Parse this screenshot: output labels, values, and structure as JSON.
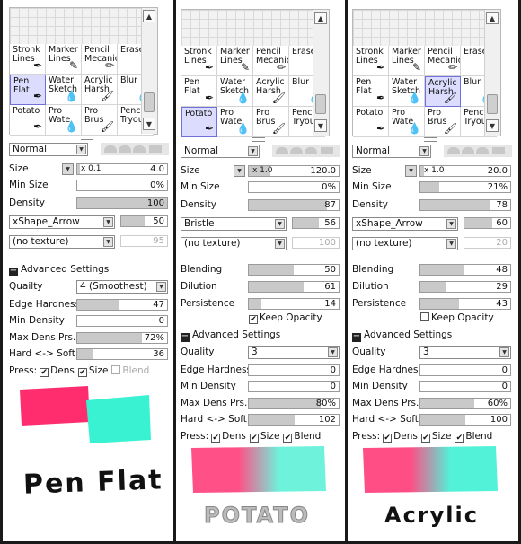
{
  "brushes": {
    "row1": [
      {
        "name": "Stronk",
        "line2": "Lines",
        "icon": "pen-icon"
      },
      {
        "name": "Marker",
        "line2": "Lines",
        "icon": "marker-icon"
      },
      {
        "name": "Pencil",
        "line2": "Mecanic",
        "icon": "pencil-icon"
      },
      {
        "name": "Eraser",
        "line2": "",
        "icon": "eraser-icon"
      }
    ],
    "row2": [
      {
        "name": "Pen",
        "line2": "Flat",
        "icon": "pen-icon"
      },
      {
        "name": "Water",
        "line2": "Sketch",
        "icon": "water-drop-icon"
      },
      {
        "name": "Acrylic",
        "line2": "Harsh",
        "icon": "brush-icon"
      },
      {
        "name": "Blur",
        "line2": "",
        "icon": "water-drop-icon"
      }
    ],
    "row3": [
      {
        "name": "Potato",
        "line2": "",
        "icon": "pen-icon"
      },
      {
        "name": "Pro Wate",
        "line2": "",
        "icon": "water-drop-icon"
      },
      {
        "name": "Pro Brus",
        "line2": "",
        "icon": "brush-icon"
      },
      {
        "name": "Pencil",
        "line2": "Tryout",
        "icon": "pencil-icon"
      }
    ]
  },
  "panels": [
    {
      "blend_mode": "Normal",
      "size_label": "Size",
      "size_mult": "x 0.1",
      "size_value": "4.0",
      "size_fill": 0.03,
      "min_size_label": "Min Size",
      "min_size_value": "0%",
      "min_size_fill": 0,
      "density_label": "Density",
      "density_value": "100",
      "density_fill": 1,
      "shape": "xShape_Arrow",
      "shape_value": "50",
      "shape_fill": 0.5,
      "texture": "(no texture)",
      "texture_value": "95",
      "advanced_label": "Advanced Settings",
      "quality_label": "Quailty",
      "quality_value": "4 (Smoothest)",
      "edge_label": "Edge Hardness",
      "edge_value": "47",
      "edge_fill": 0.47,
      "min_density_label": "Min Density",
      "min_density_value": "0",
      "min_density_fill": 0,
      "max_dens_label": "Max Dens Prs.",
      "max_dens_value": "72%",
      "max_dens_fill": 0.72,
      "hard_soft_label": "Hard <-> Soft",
      "hard_soft_value": "36",
      "hard_soft_fill": 0.18,
      "press_label": "Press:",
      "dens_label": "Dens",
      "size_cb_label": "Size",
      "blend_label": "Blend",
      "sample_title": "Pen Flat",
      "colors": {
        "pink": "#ff2d6e",
        "teal": "#39f2d2"
      }
    },
    {
      "blend_mode": "Normal",
      "size_label": "Size",
      "size_mult": "x 1.0",
      "size_value": "120.0",
      "size_fill": 0.24,
      "min_size_label": "Min Size",
      "min_size_value": "0%",
      "min_size_fill": 0,
      "density_label": "Density",
      "density_value": "87",
      "density_fill": 0.87,
      "shape": "Bristle",
      "shape_value": "56",
      "shape_fill": 0.56,
      "texture": "(no texture)",
      "texture_value": "100",
      "blending_label": "Blending",
      "blending_value": "50",
      "blending_fill": 0.5,
      "dilution_label": "Dilution",
      "dilution_value": "61",
      "dilution_fill": 0.61,
      "persistence_label": "Persistence",
      "persistence_value": "14",
      "persistence_fill": 0.14,
      "keep_opacity_label": "Keep Opacity",
      "advanced_label": "Advanced Settings",
      "quality_label": "Quality",
      "quality_value": "3",
      "edge_label": "Edge Hardness",
      "edge_value": "0",
      "edge_fill": 0,
      "min_density_label": "Min Density",
      "min_density_value": "0",
      "min_density_fill": 0,
      "max_dens_label": "Max Dens Prs.",
      "max_dens_value": "80%",
      "max_dens_fill": 0.8,
      "hard_soft_label": "Hard <-> Soft",
      "hard_soft_value": "102",
      "hard_soft_fill": 0.51,
      "press_label": "Press:",
      "dens_label": "Dens",
      "size_cb_label": "Size",
      "blend_label": "Blend",
      "sample_title": "POTATO",
      "colors": {
        "pink": "#ff3d7a",
        "teal": "#5ef0d8"
      }
    },
    {
      "blend_mode": "Normal",
      "size_label": "Size",
      "size_mult": "x 1.0",
      "size_value": "20.0",
      "size_fill": 0.04,
      "min_size_label": "Min Size",
      "min_size_value": "21%",
      "min_size_fill": 0.21,
      "density_label": "Density",
      "density_value": "78",
      "density_fill": 0.78,
      "shape": "xShape_Arrow",
      "shape_value": "60",
      "shape_fill": 0.6,
      "texture": "(no texture)",
      "texture_value": "20",
      "blending_label": "Blending",
      "blending_value": "48",
      "blending_fill": 0.48,
      "dilution_label": "Dilution",
      "dilution_value": "29",
      "dilution_fill": 0.29,
      "persistence_label": "Persistence",
      "persistence_value": "43",
      "persistence_fill": 0.43,
      "keep_opacity_label": "Keep Opacity",
      "advanced_label": "Advanced Settings",
      "quality_label": "Quality",
      "quality_value": "3",
      "edge_label": "Edge Hardness",
      "edge_value": "0",
      "edge_fill": 0,
      "min_density_label": "Min Density",
      "min_density_value": "0",
      "min_density_fill": 0,
      "max_dens_label": "Max Dens Prs.",
      "max_dens_value": "60%",
      "max_dens_fill": 0.6,
      "hard_soft_label": "Hard <-> Soft",
      "hard_soft_value": "100",
      "hard_soft_fill": 0.5,
      "press_label": "Press:",
      "dens_label": "Dens",
      "size_cb_label": "Size",
      "blend_label": "Blend",
      "sample_title": "Acrylic",
      "colors": {
        "pink": "#ff3a78",
        "teal": "#3ff0d5"
      }
    }
  ]
}
